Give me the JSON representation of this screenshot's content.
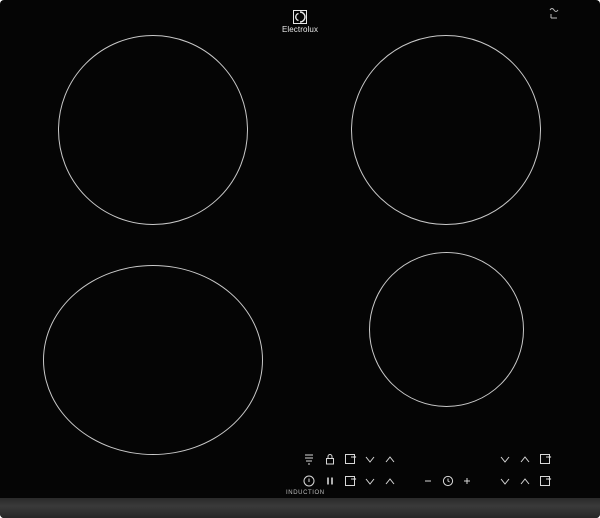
{
  "brand": {
    "name": "Electrolux",
    "logo_icon": "electrolux-logo-icon"
  },
  "corner_mark_icon": "tilde-mark-icon",
  "cooking_zones": [
    {
      "id": "rear-left"
    },
    {
      "id": "rear-right"
    },
    {
      "id": "front-left"
    },
    {
      "id": "front-right"
    }
  ],
  "controls": {
    "row1": [
      "zone-select-icon",
      "lock-icon",
      "timer-icon",
      "chevron-down-icon",
      "chevron-up-icon",
      "chevron-down-icon",
      "chevron-up-icon",
      "timer-icon"
    ],
    "row2": [
      "power-icon",
      "pause-icon",
      "timer-icon",
      "chevron-down-icon",
      "chevron-up-icon",
      "minus-icon",
      "clock-icon",
      "plus-icon",
      "chevron-down-icon",
      "chevron-up-icon",
      "timer-icon"
    ]
  },
  "label": {
    "text": "INDUCTION"
  },
  "colors": {
    "glass": "#050505",
    "frame": "#2e2e2e",
    "markings": "#c9c9c9"
  }
}
